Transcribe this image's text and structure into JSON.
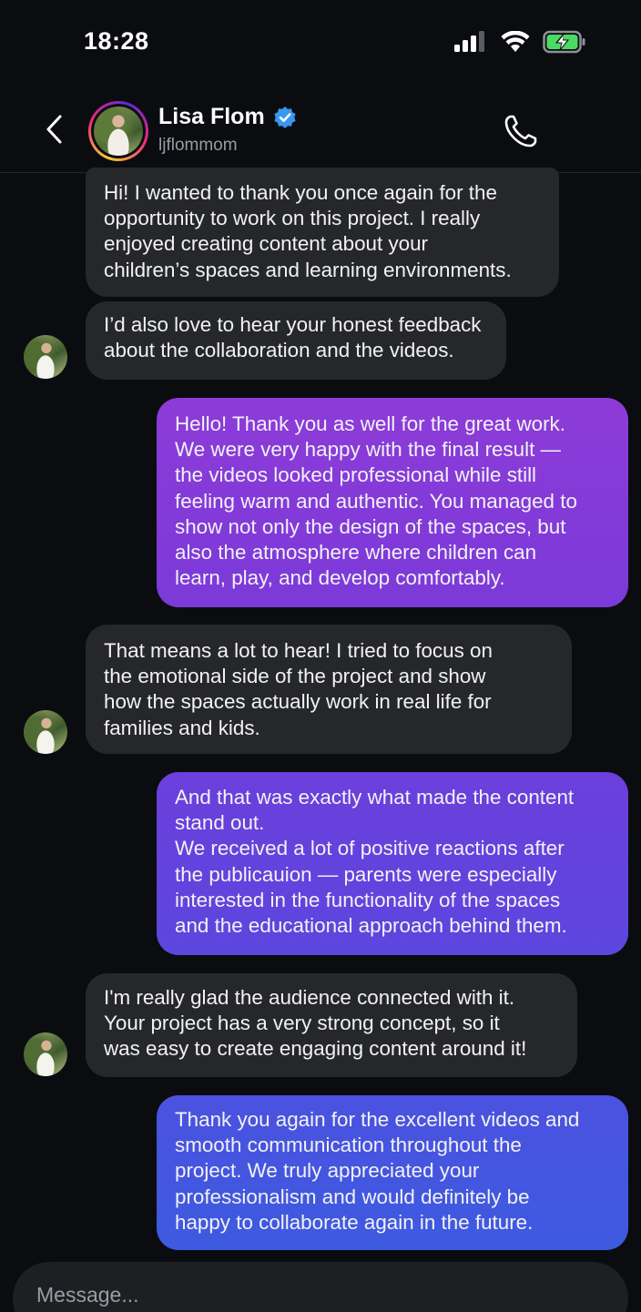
{
  "status_bar": {
    "time": "18:28",
    "icons": [
      "signal-icon",
      "wifi-icon",
      "battery-charging-icon"
    ]
  },
  "header": {
    "name": "Lisa Flom",
    "handle": "ljflommom",
    "verified": true,
    "icons": [
      "back-chevron-icon",
      "verified-badge-icon",
      "phone-call-icon"
    ]
  },
  "colors": {
    "background": "#0b0c10",
    "incoming_bubble": "#262729",
    "outgoing_gradient_top": "#8e3ad8",
    "outgoing_gradient_bottom": "#3b5ae0",
    "verified_blue": "#3897f0"
  },
  "messages": [
    {
      "direction": "incoming",
      "text": "Hi! I wanted to thank you once again for the\nopportunity to work on this project. I really\nenjoyed creating content about your\nchildren’s spaces and learning environments."
    },
    {
      "direction": "incoming",
      "text": "I’d also love to hear your honest feedback\nabout the collaboration and the videos."
    },
    {
      "direction": "outgoing",
      "text": "Hello! Thank you as well for the great work.\nWe were very happy with the final result —\nthe videos looked professional while still\nfeeling warm and authentic. You managed to\nshow not only the design of the spaces, but\nalso the atmosphere where children can\nlearn, play, and develop comfortably."
    },
    {
      "direction": "incoming",
      "text": "That means a lot to hear! I tried to focus on\nthe emotional side of the project and show\nhow the spaces actually work in real life for\nfamilies and kids."
    },
    {
      "direction": "outgoing",
      "text": "And that was exactly what made the content\nstand out.\nWe received a lot of positive reactions after\nthe publicauion — parents were especially\ninterested in the functionality of the spaces\nand the educational approach behind them."
    },
    {
      "direction": "incoming",
      "text": "I'm really glad the audience connected with it.\nYour project has a very strong concept, so it\nwas easy to create engaging content around it!"
    },
    {
      "direction": "outgoing",
      "text": "Thank you again for the excellent videos and\nsmooth communication throughout the\nproject. We truly appreciated your\nprofessionalism and would definitely be\nhappy to collaborate again in the future."
    }
  ],
  "composer": {
    "placeholder": "Message..."
  }
}
